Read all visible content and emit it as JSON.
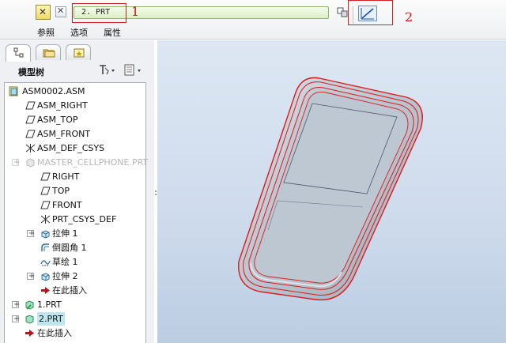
{
  "dashboard": {
    "part_value": "2. PRT",
    "annotation_1": "1",
    "annotation_2": "2",
    "tabs": [
      "参照",
      "选项",
      "属性"
    ]
  },
  "left_panel": {
    "tree_title": "模型树"
  },
  "tree": [
    {
      "label": "ASM0002.ASM",
      "icon": "assembly-icon"
    },
    {
      "label": "ASM_RIGHT",
      "icon": "datum-plane-icon"
    },
    {
      "label": "ASM_TOP",
      "icon": "datum-plane-icon"
    },
    {
      "label": "ASM_FRONT",
      "icon": "datum-plane-icon"
    },
    {
      "label": "ASM_DEF_CSYS",
      "icon": "csys-icon"
    },
    {
      "label": "MASTER_CELLPHONE.PRT",
      "icon": "part-icon",
      "dim": true
    },
    {
      "label": "RIGHT",
      "icon": "datum-plane-icon"
    },
    {
      "label": "TOP",
      "icon": "datum-plane-icon"
    },
    {
      "label": "FRONT",
      "icon": "datum-plane-icon"
    },
    {
      "label": "PRT_CSYS_DEF",
      "icon": "csys-icon"
    },
    {
      "label": "拉伸 1",
      "icon": "extrude-icon"
    },
    {
      "label": "倒圆角 1",
      "icon": "round-icon"
    },
    {
      "label": "草绘 1",
      "icon": "sketch-icon"
    },
    {
      "label": "拉伸 2",
      "icon": "extrude-icon"
    },
    {
      "label": "在此插入",
      "icon": "insert-arrow-icon"
    },
    {
      "label": "1.PRT",
      "icon": "part-icon"
    },
    {
      "label": "2.PRT",
      "icon": "part-icon",
      "selected": true
    },
    {
      "label": "在此插入",
      "icon": "insert-arrow-icon"
    }
  ],
  "colors": {
    "annotation": "#d42020",
    "insert_arrow": "#b01818",
    "model_surface": "#b7c3cf",
    "highlight_edge": "#e01818"
  }
}
